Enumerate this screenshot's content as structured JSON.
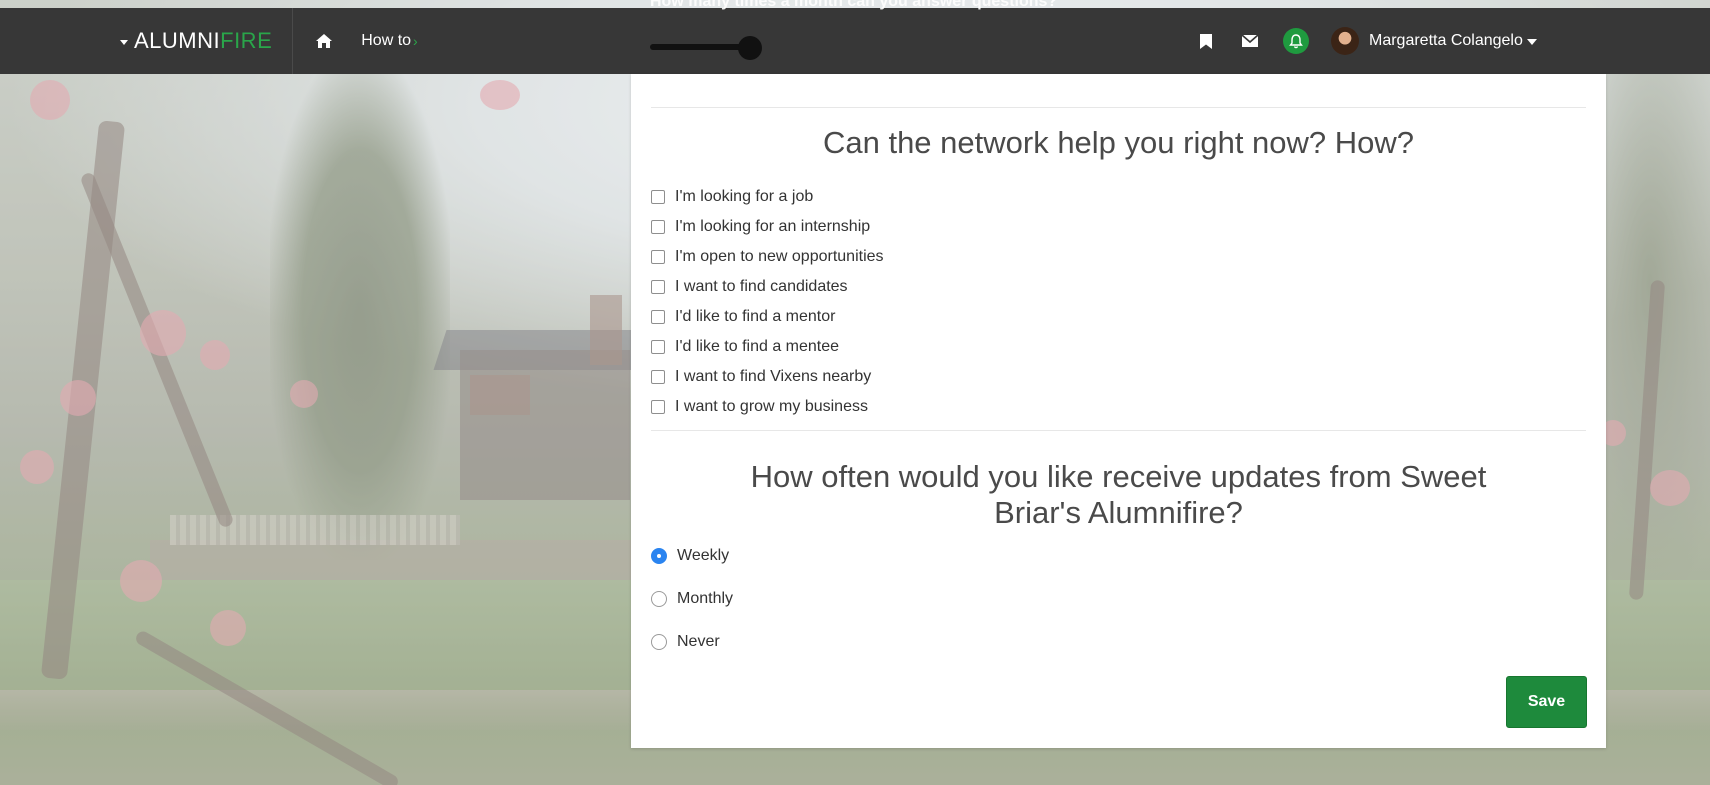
{
  "navbar": {
    "brand_part1": "ALUMNI",
    "brand_part2": "FIRE",
    "home_icon": "home-icon",
    "howto_label": "How to",
    "howto_chevron": "›",
    "icons": [
      "bookmark-icon",
      "envelope-icon",
      "bell-icon"
    ],
    "user_name": "Margaretta Colangelo",
    "colors": {
      "background": "#373737",
      "brand_accent": "#2aa54a",
      "bell_bg": "#1f9a3f"
    }
  },
  "slider": {
    "question": "How many times a month can you answer questions?",
    "value_fraction": 0.2
  },
  "help_section": {
    "title": "Can the network help you right now? How?",
    "options": [
      {
        "label": "I'm looking for a job",
        "checked": false
      },
      {
        "label": "I'm looking for an internship",
        "checked": false
      },
      {
        "label": "I'm open to new opportunities",
        "checked": false
      },
      {
        "label": "I want to find candidates",
        "checked": false
      },
      {
        "label": "I'd like to find a mentor",
        "checked": false
      },
      {
        "label": "I'd like to find a mentee",
        "checked": false
      },
      {
        "label": "I want to find Vixens nearby",
        "checked": false
      },
      {
        "label": "I want to grow my business",
        "checked": false
      }
    ]
  },
  "updates_section": {
    "title": "How often would you like receive updates from Sweet Briar's Alumnifire?",
    "options": [
      {
        "label": "Weekly",
        "selected": true
      },
      {
        "label": "Monthly",
        "selected": false
      },
      {
        "label": "Never",
        "selected": false
      }
    ]
  },
  "actions": {
    "save_label": "Save",
    "save_color": "#1e8a3c"
  }
}
